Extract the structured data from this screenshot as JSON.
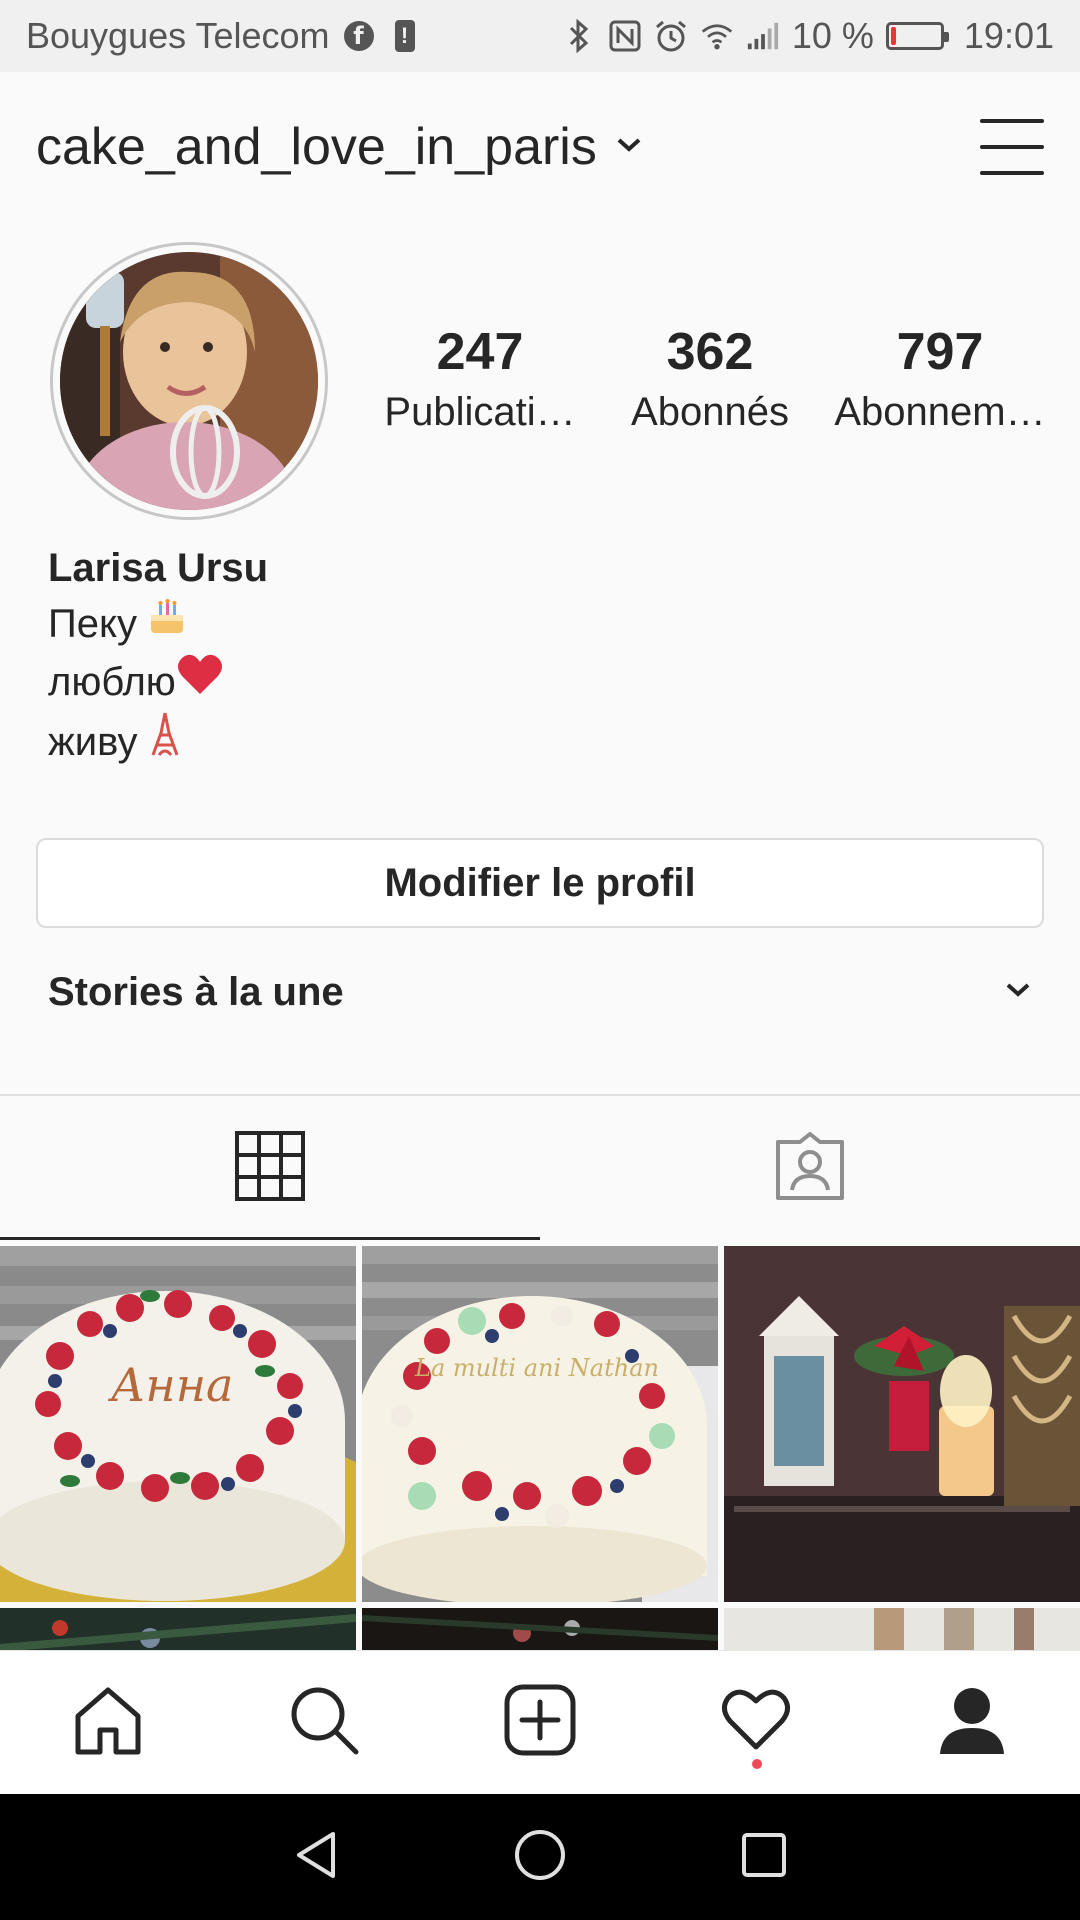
{
  "status_bar": {
    "carrier": "Bouygues Telecom",
    "battery_text": "10 %",
    "battery_level": 0.1,
    "time": "19:01",
    "icons": [
      "facebook-icon",
      "alert-icon",
      "bluetooth-icon",
      "nfc-icon",
      "alarm-icon",
      "wifi-icon",
      "signal-icon",
      "battery-icon"
    ]
  },
  "header": {
    "username": "cake_and_love_in_paris",
    "icons": [
      "chevron-down-icon",
      "menu-icon"
    ]
  },
  "profile": {
    "stats": [
      {
        "value": "247",
        "label": "Publicati…"
      },
      {
        "value": "362",
        "label": "Abonnés"
      },
      {
        "value": "797",
        "label": "Abonnem…"
      }
    ],
    "name": "Larisa Ursu",
    "bio_lines": [
      "Пеку",
      "люблю",
      "живу"
    ],
    "bio_emoji": [
      "birthday-cake-emoji",
      "red-heart-emoji",
      "eiffel-tower-emoji"
    ]
  },
  "edit_profile_label": "Modifier le profil",
  "stories_label": "Stories à la une",
  "tabs": [
    "grid-icon",
    "tagged-icon"
  ],
  "posts": [
    {
      "text": "Анна"
    },
    {
      "text": "La multi ani Nathan"
    },
    {
      "text": ""
    }
  ],
  "bottom_nav": [
    "home-icon",
    "search-icon",
    "new-post-icon",
    "activity-heart-icon",
    "profile-icon"
  ],
  "colors": {
    "accent": "#262626",
    "notification": "#ed4956",
    "battery_low": "#e53935",
    "border": "#dbdbdb"
  }
}
